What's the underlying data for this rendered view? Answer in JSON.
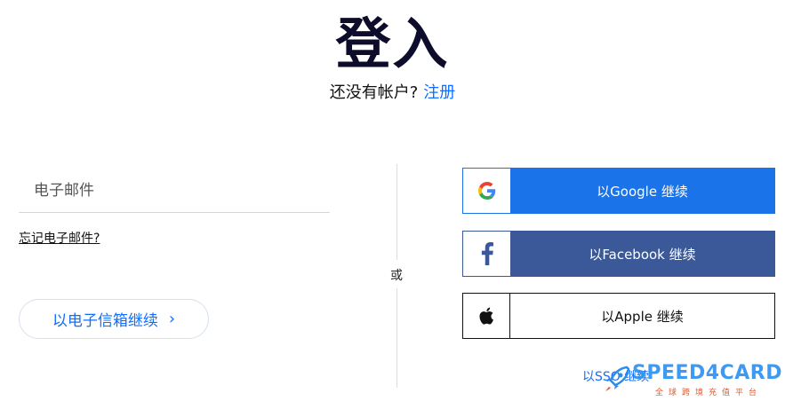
{
  "header": {
    "title": "登入",
    "subtitle_text": "还没有帐户?",
    "signup_link": "注册"
  },
  "email_form": {
    "email_placeholder": "电子邮件",
    "forgot_link": "忘记电子邮件?",
    "continue_button": "以电子信箱继续",
    "continue_chevron": "›"
  },
  "divider": {
    "or_label": "或"
  },
  "social": {
    "google_label": "以Google 继续",
    "facebook_label": "以Facebook 继续",
    "apple_label": "以Apple 继续",
    "sso_link": "以SSO 继续"
  },
  "watermark": {
    "brand": "SPEED4CARD",
    "tagline": "全球跨境充值平台"
  },
  "colors": {
    "accent_blue": "#116dff",
    "google_blue": "#1a73e8",
    "facebook_blue": "#3b5998",
    "title_color": "#0d0d2b"
  }
}
